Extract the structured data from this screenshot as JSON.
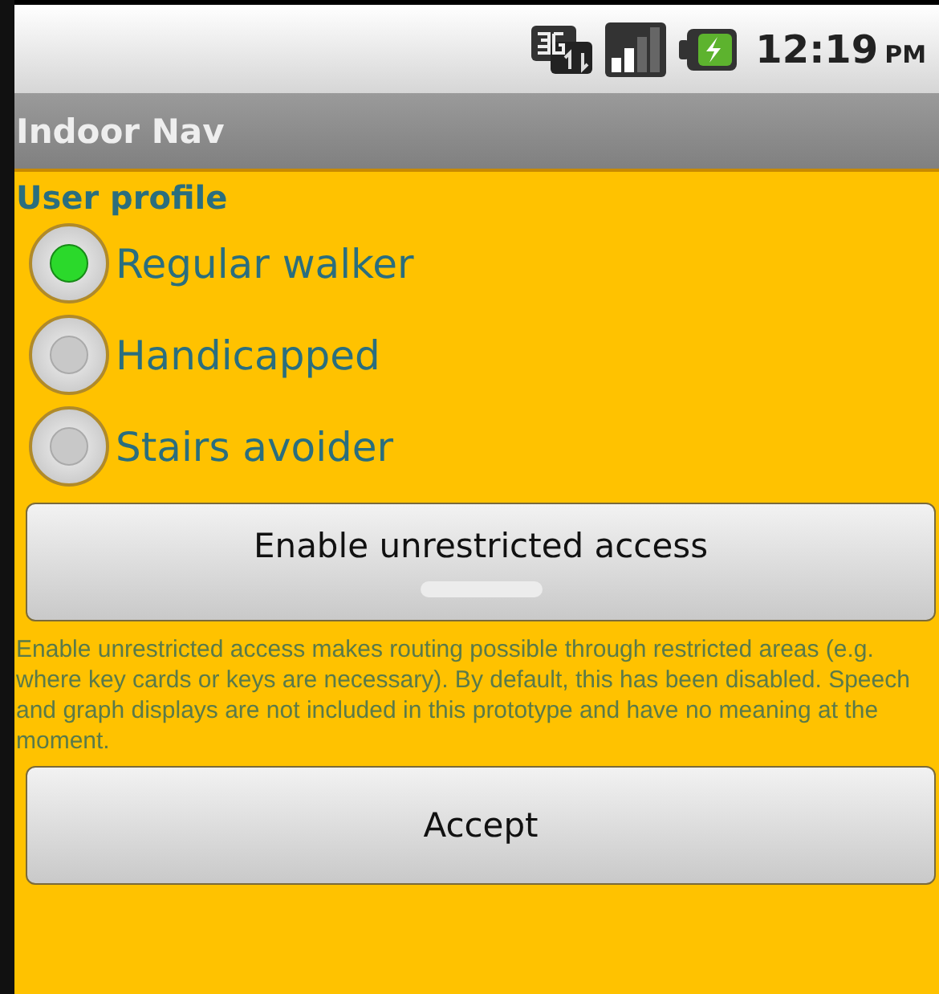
{
  "status_bar": {
    "time": "12:19",
    "ampm": "PM"
  },
  "title_bar": {
    "title": "Indoor Nav"
  },
  "user_profile": {
    "heading": "User profile",
    "options": [
      {
        "label": "Regular walker",
        "selected": true
      },
      {
        "label": "Handicapped",
        "selected": false
      },
      {
        "label": "Stairs avoider",
        "selected": false
      }
    ]
  },
  "toggle": {
    "label": "Enable unrestricted access",
    "on": false
  },
  "description": "Enable unrestricted access makes routing possible through restricted areas (e.g. where key cards or keys are necessary). By default, this has been disabled. Speech and graph displays are not included in this prototype and have no meaning at the moment.",
  "accept_button": {
    "label": "Accept"
  }
}
